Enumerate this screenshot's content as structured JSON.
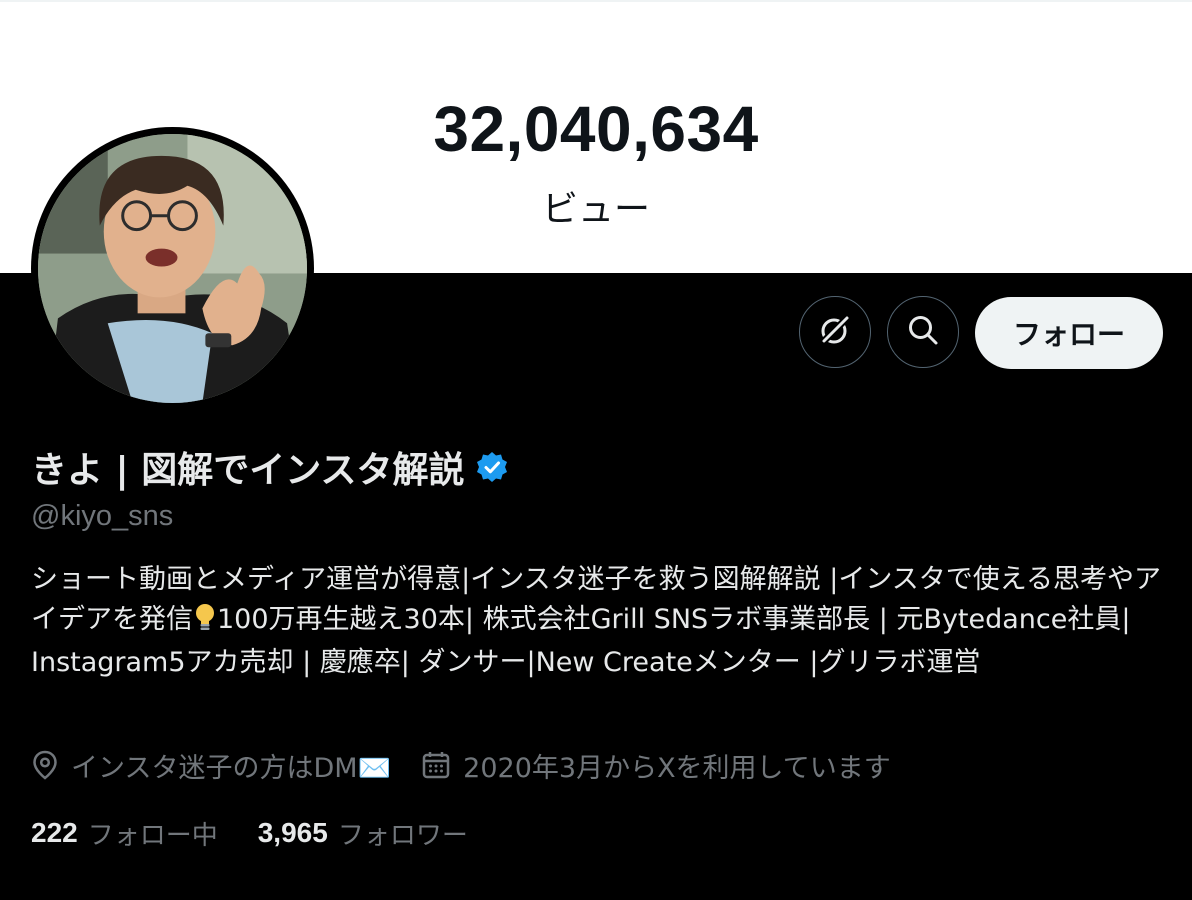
{
  "views": {
    "count": "32,040,634",
    "label": "ビュー"
  },
  "profile": {
    "display_name": "きよ | 図解でインスタ解説",
    "handle": "@kiyo_sns",
    "bio_part1": "ショート動画とメディア運営が得意|インスタ迷子を救う図解解説 |インスタで使える思考やアイデアを発信",
    "bio_part2": "100万再生越え30本| 株式会社Grill SNSラボ事業部長 | 元Bytedance社員| Instagram5アカ売却 | 慶應卒| ダンサー|New Createメンター |グリラボ運営",
    "location": "インスタ迷子の方はDM✉️",
    "joined": "2020年3月からXを利用しています"
  },
  "stats": {
    "following_count": "222",
    "following_label": "フォロー中",
    "followers_count": "3,965",
    "followers_label": "フォロワー"
  },
  "actions": {
    "follow_label": "フォロー"
  },
  "icons": {
    "grok": "grok-icon",
    "search": "search-icon",
    "verified": "verified-badge-icon",
    "location": "location-pin-icon",
    "calendar": "calendar-icon",
    "bulb": "light-bulb-icon"
  },
  "colors": {
    "background": "#000000",
    "top_background": "#ffffff",
    "primary_text": "#e7e9ea",
    "secondary_text": "#71767b",
    "verified": "#1d9bf0",
    "follow_button_bg": "#eff3f4"
  }
}
